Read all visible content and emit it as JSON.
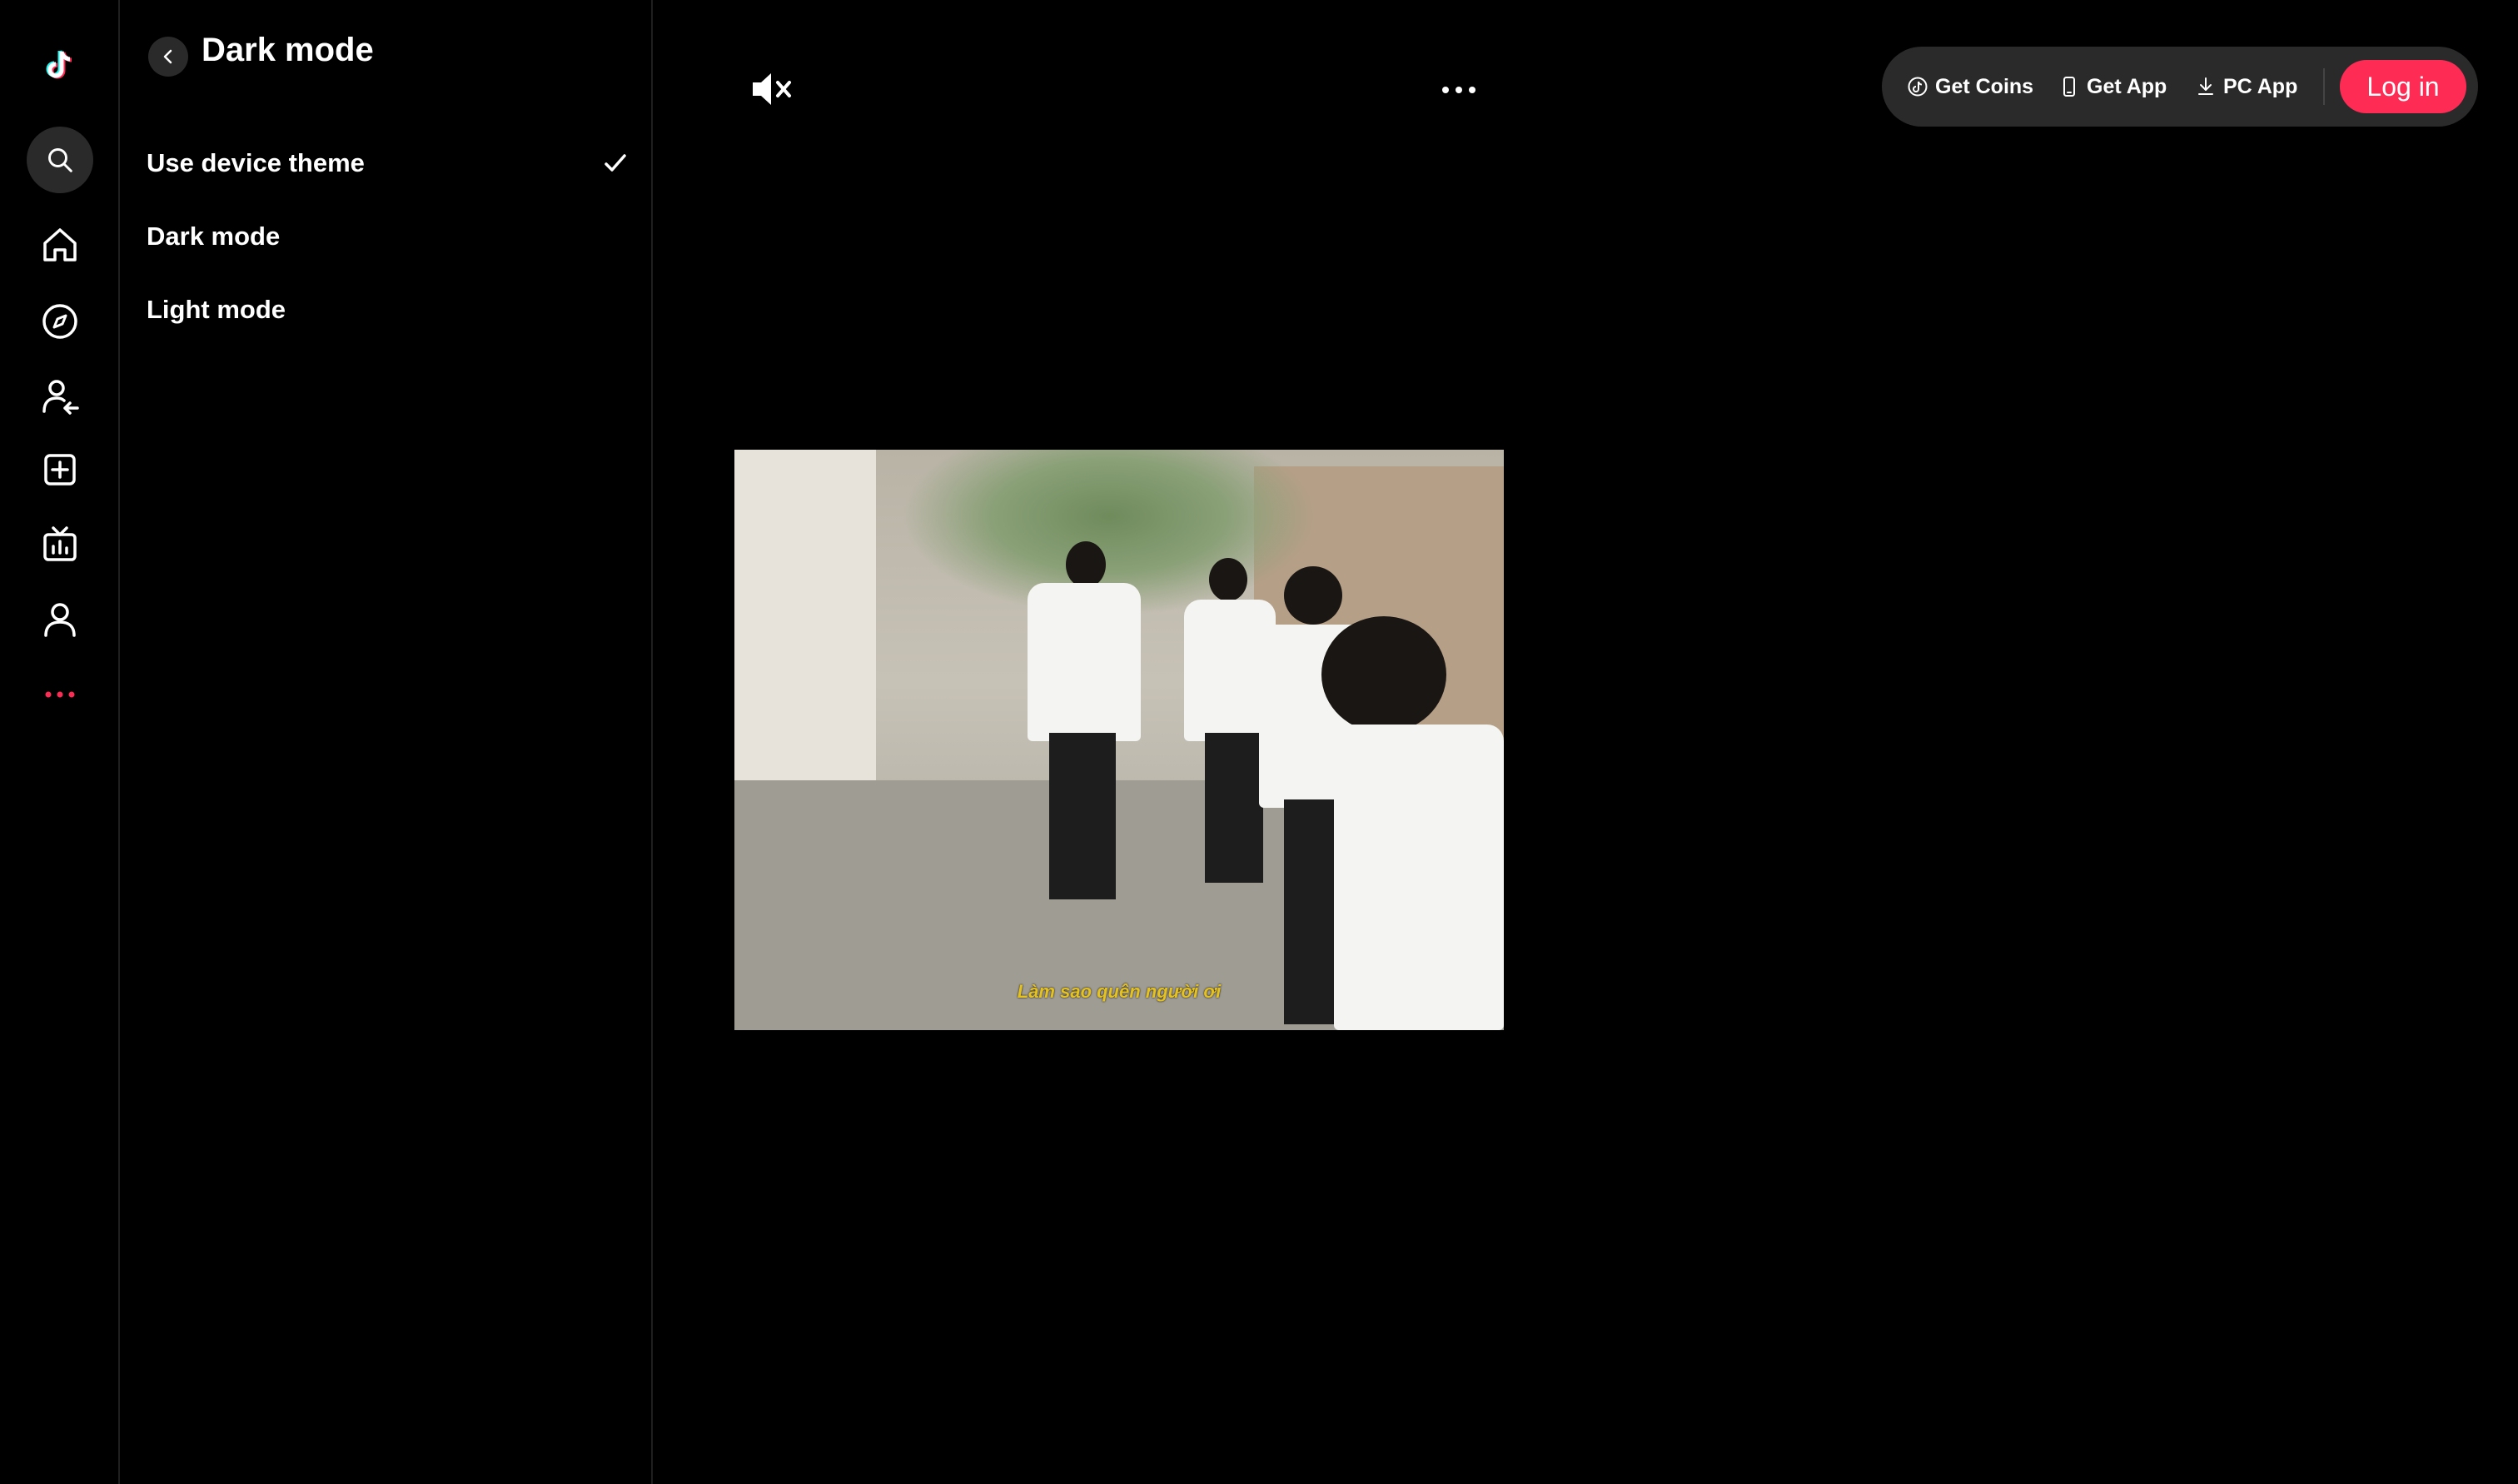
{
  "sidebar": {
    "items": [
      {
        "name": "logo",
        "icon": "tiktok-logo-icon"
      },
      {
        "name": "search",
        "icon": "search-icon"
      },
      {
        "name": "home",
        "icon": "home-icon"
      },
      {
        "name": "explore",
        "icon": "compass-icon"
      },
      {
        "name": "following",
        "icon": "following-icon"
      },
      {
        "name": "upload",
        "icon": "plus-square-icon"
      },
      {
        "name": "live",
        "icon": "live-tv-icon"
      },
      {
        "name": "profile",
        "icon": "profile-icon"
      },
      {
        "name": "more",
        "icon": "more-dots-icon"
      }
    ],
    "accent": "#fe2c55"
  },
  "panel": {
    "title": "Dark mode",
    "options": [
      {
        "label": "Use device theme",
        "selected": true
      },
      {
        "label": "Dark mode",
        "selected": false
      },
      {
        "label": "Light mode",
        "selected": false
      }
    ]
  },
  "video": {
    "caption": "Làm sao quên người ơi",
    "muted": true
  },
  "topbar": {
    "get_coins": "Get Coins",
    "get_app": "Get App",
    "pc_app": "PC App",
    "login": "Log in",
    "login_color": "#fe2c55"
  }
}
